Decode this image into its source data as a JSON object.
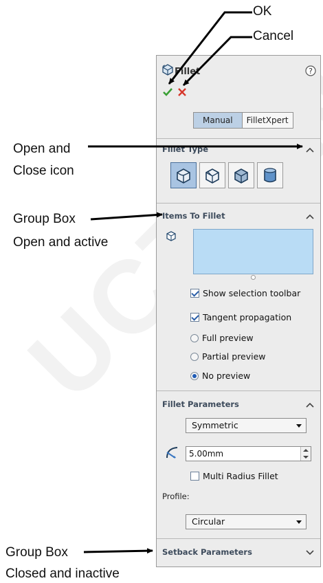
{
  "callouts": {
    "ok": "OK",
    "cancel": "Cancel",
    "open_close_1": "Open and",
    "open_close_2": "Close icon",
    "group_open_1": "Group Box",
    "group_open_2": "Open and active",
    "group_closed_1": "Group Box",
    "group_closed_2": "Closed and inactive"
  },
  "watermark": "UCTION",
  "panel": {
    "title": "Fillet",
    "help_icon": "help-icon",
    "ok_icon": "check-icon",
    "cancel_icon": "x-icon",
    "modes": {
      "manual": "Manual",
      "filletxpert": "FilletXpert",
      "active": "Manual"
    },
    "fillet_type": {
      "title": "Fillet Type",
      "buttons": [
        "constant-size-fillet-icon",
        "variable-size-fillet-icon",
        "face-fillet-icon",
        "full-round-fillet-icon"
      ],
      "selected": 0
    },
    "items_to_fillet": {
      "title": "Items To Fillet",
      "icon": "edge-selection-icon",
      "show_toolbar": {
        "label": "Show selection toolbar",
        "checked": true
      },
      "tangent": {
        "label": "Tangent propagation",
        "checked": true
      },
      "preview_options": [
        "Full preview",
        "Partial preview",
        "No preview"
      ],
      "preview_selected": "No preview"
    },
    "fillet_parameters": {
      "title": "Fillet Parameters",
      "method": "Symmetric",
      "radius_icon": "radius-icon",
      "radius": "5.00mm",
      "multi_radius": {
        "label": "Multi Radius Fillet",
        "checked": false
      },
      "profile_label": "Profile:",
      "profile": "Circular"
    },
    "setback_parameters": {
      "title": "Setback Parameters",
      "collapsed": true
    }
  }
}
